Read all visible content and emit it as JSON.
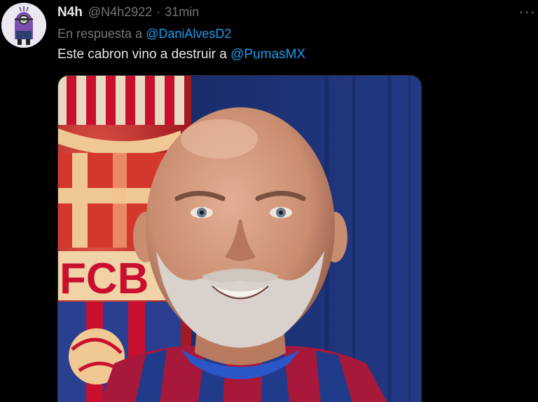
{
  "tweet": {
    "author_name": "N4h",
    "author_handle": "@N4h2922",
    "separator": "·",
    "timestamp": "31min",
    "replying_prefix": "En respuesta a",
    "replying_to": "@DaniAlvesD2",
    "text_before_mention": "Este cabron vino a destruir a",
    "text_mention": "@PumasMX",
    "more_icon": "more-horizontal-icon",
    "media_crest_text": "FCB"
  },
  "colors": {
    "background": "#000000",
    "text_primary": "#e7e9ea",
    "text_secondary": "#71767b",
    "link": "#1d9bf0",
    "crest_red": "#c8102e",
    "crest_blue": "#1f3b8a"
  }
}
